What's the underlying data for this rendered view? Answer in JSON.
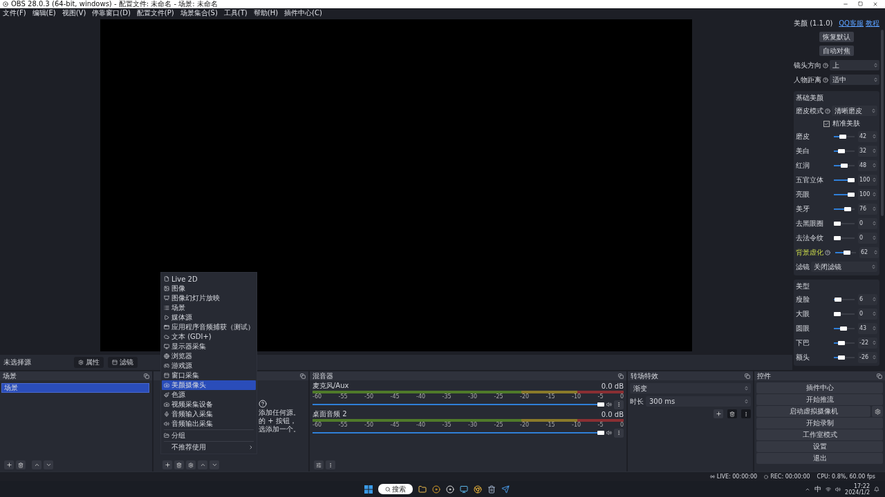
{
  "window": {
    "title": "OBS 28.0.3 (64-bit, windows) - 配置文件: 未命名 - 场景: 未命名"
  },
  "menu": [
    "文件(F)",
    "编辑(E)",
    "视图(V)",
    "停靠窗口(D)",
    "配置文件(P)",
    "场景集合(S)",
    "工具(T)",
    "帮助(H)",
    "插件中心(C)"
  ],
  "preview": {
    "source_label": "未选择源",
    "buttons": [
      "属性",
      "滤镜"
    ]
  },
  "beauty_panel": {
    "title": "美颜 (1.1.0)",
    "links": [
      "QQ客服",
      "教程"
    ],
    "buttons": [
      "恢复默认",
      "自动对焦"
    ],
    "selects": [
      {
        "label": "镜头方向",
        "value": "上"
      },
      {
        "label": "人物距离",
        "value": "适中"
      }
    ],
    "sections": [
      {
        "title": "基础美颜",
        "rows": [
          {
            "kind": "select",
            "label": "磨皮模式",
            "help": true,
            "value": "清晰磨皮"
          },
          {
            "kind": "checkbox",
            "label": "精准美肤",
            "checked": true
          },
          {
            "kind": "slider",
            "label": "磨皮",
            "level": 0.42,
            "value": "42"
          },
          {
            "kind": "slider",
            "label": "美白",
            "level": 0.32,
            "value": "32"
          },
          {
            "kind": "slider",
            "label": "红润",
            "level": 0.48,
            "value": "48"
          },
          {
            "kind": "slider",
            "label": "五官立体",
            "level": 1,
            "value": "100"
          },
          {
            "kind": "slider",
            "label": "亮眼",
            "level": 1,
            "value": "100"
          },
          {
            "kind": "slider",
            "label": "美牙",
            "level": 0.76,
            "value": "76"
          },
          {
            "kind": "slider",
            "label": "去黑眼圈",
            "level": 0,
            "value": "0"
          },
          {
            "kind": "slider",
            "label": "去法令纹",
            "level": 0,
            "value": "0"
          },
          {
            "kind": "slider",
            "label": "背景虚化",
            "help": true,
            "highlighted": true,
            "level": 0.62,
            "value": "62"
          },
          {
            "kind": "select",
            "label": "滤镜",
            "value": "关闭滤镜"
          }
        ]
      },
      {
        "title": "美型",
        "rows": [
          {
            "kind": "slider",
            "label": "瘦脸",
            "level": 0.06,
            "value": "6"
          },
          {
            "kind": "slider",
            "label": "大眼",
            "level": 0,
            "value": "0"
          },
          {
            "kind": "slider",
            "label": "圆眼",
            "level": 0.43,
            "value": "43"
          },
          {
            "kind": "slider",
            "label": "下巴",
            "level": 0.3,
            "value": "-22"
          },
          {
            "kind": "slider",
            "label": "额头",
            "level": 0.28,
            "value": "-26"
          }
        ]
      }
    ]
  },
  "scenes": {
    "title": "场景",
    "items": [
      {
        "label": "场景",
        "selected": true
      }
    ]
  },
  "sources": {
    "hint_lines": [
      "添加任何源。",
      "的 + 按钮，",
      "选添加一个。"
    ]
  },
  "mixer": {
    "title": "混音器",
    "channels": [
      {
        "name": "麦克风/Aux",
        "reading": "0.0 dB",
        "level": 1,
        "ticks": [
          "-60",
          "-55",
          "-50",
          "-45",
          "-40",
          "-35",
          "-30",
          "-25",
          "-20",
          "-15",
          "-10",
          "-5",
          "0"
        ]
      },
      {
        "name": "桌面音频 2",
        "reading": "0.0 dB",
        "level": 1,
        "ticks": [
          "-60",
          "-55",
          "-50",
          "-45",
          "-40",
          "-35",
          "-30",
          "-25",
          "-20",
          "-15",
          "-10",
          "-5",
          "0"
        ]
      }
    ]
  },
  "transitions": {
    "title": "转场特效",
    "value": "渐变",
    "duration_label": "时长",
    "duration": "300 ms"
  },
  "controls": {
    "title": "控件",
    "buttons": [
      {
        "label": "插件中心",
        "kind": "plain"
      },
      {
        "label": "开始推流",
        "kind": "plain"
      },
      {
        "label": "启动虚拟摄像机",
        "kind": "with_settings"
      },
      {
        "label": "开始录制",
        "kind": "plain"
      },
      {
        "label": "工作室模式",
        "kind": "plain"
      },
      {
        "label": "设置",
        "kind": "plain"
      },
      {
        "label": "退出",
        "kind": "plain"
      }
    ]
  },
  "context_menu": {
    "items": [
      {
        "kind": "item",
        "label": "Live 2D",
        "selected": false
      },
      {
        "kind": "item",
        "label": "图像",
        "selected": false
      },
      {
        "kind": "item",
        "label": "图像幻灯片放映",
        "selected": false
      },
      {
        "kind": "item",
        "label": "场景",
        "selected": false
      },
      {
        "kind": "item",
        "label": "媒体源",
        "selected": false
      },
      {
        "kind": "item",
        "label": "应用程序音频捕获（测试）",
        "selected": false
      },
      {
        "kind": "item",
        "label": "文本 (GDI+)",
        "selected": false
      },
      {
        "kind": "item",
        "label": "显示器采集",
        "selected": false
      },
      {
        "kind": "item",
        "label": "浏览器",
        "selected": false
      },
      {
        "kind": "item",
        "label": "游戏源",
        "selected": false
      },
      {
        "kind": "item",
        "label": "窗口采集",
        "selected": false
      },
      {
        "kind": "item",
        "label": "美颜摄像头",
        "selected": true
      },
      {
        "kind": "item",
        "label": "色源",
        "selected": false
      },
      {
        "kind": "item",
        "label": "视频采集设备",
        "selected": false
      },
      {
        "kind": "item",
        "label": "音频输入采集",
        "selected": false
      },
      {
        "kind": "item",
        "label": "音频输出采集",
        "selected": false
      },
      {
        "kind": "separator"
      },
      {
        "kind": "item",
        "label": "分组",
        "selected": false
      },
      {
        "kind": "separator"
      },
      {
        "kind": "submenu",
        "label": "不推荐使用",
        "selected": false
      }
    ]
  },
  "status_bar": {
    "live": "LIVE: 00:00:00",
    "rec": "REC: 00:00:00",
    "cpu": "CPU: 0.8%, 60.00 fps"
  },
  "taskbar": {
    "search": "搜索",
    "ime": "中",
    "time": "17:22",
    "date": "2024/1/2"
  }
}
